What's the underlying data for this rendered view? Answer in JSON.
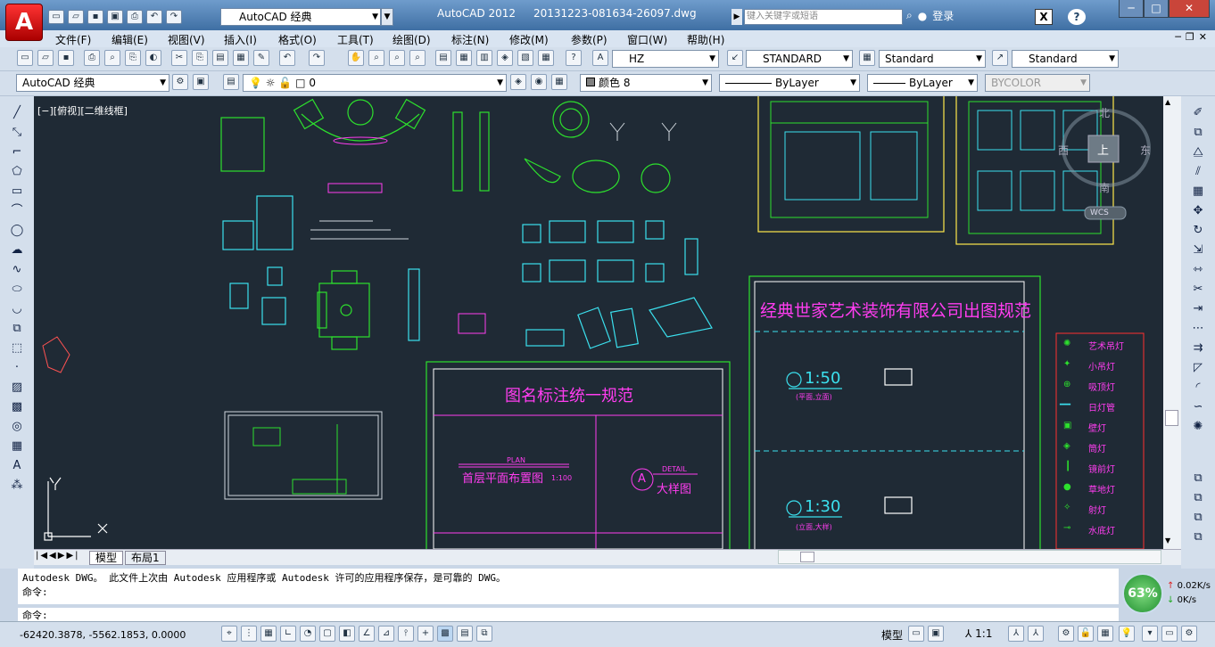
{
  "titlebar": {
    "app_name": "AutoCAD 2012",
    "file_name": "20131223-081634-26097.dwg",
    "workspace": "AutoCAD 经典",
    "search_placeholder": "键入关键字或短语",
    "login": "登录"
  },
  "menu": [
    "文件(F)",
    "编辑(E)",
    "视图(V)",
    "插入(I)",
    "格式(O)",
    "工具(T)",
    "绘图(D)",
    "标注(N)",
    "修改(M)",
    "参数(P)",
    "窗口(W)",
    "帮助(H)"
  ],
  "toolbar1": {
    "text_style": "HZ",
    "dim_style": "STANDARD",
    "table_style": "Standard",
    "mleader_style": "Standard"
  },
  "toolbar2": {
    "workspace": "AutoCAD 经典",
    "layer": "0",
    "color": "颜色 8",
    "linetype": "ByLayer",
    "lineweight": "ByLayer",
    "plotstyle": "BYCOLOR"
  },
  "viewport": {
    "label": "[−][俯视][二维线框]"
  },
  "viewcube": {
    "north": "北",
    "east": "东",
    "south": "南",
    "west": "西",
    "top": "上",
    "wcs": "WCS"
  },
  "drawing": {
    "title_main": "经典世家艺术装饰有限公司出图规范",
    "title_names": "图名标注统一规范",
    "plan_title": "首层平面布置图",
    "plan_scale": "1:100",
    "detail_title": "大样图",
    "detail_letter": "A",
    "plan_tag": "PLAN",
    "detail_tag": "DETAIL",
    "scale1": "1:50",
    "scale1_note": "(平面,立面)",
    "scale2": "1:30",
    "scale2_note": "(立面,大样)",
    "legend": [
      "艺术吊灯",
      "小吊灯",
      "吸顶灯",
      "日灯管",
      "壁灯",
      "筒灯",
      "镜前灯",
      "草地灯",
      "射灯",
      "水底灯"
    ]
  },
  "tabs": [
    "模型",
    "布局1"
  ],
  "command": {
    "line1": "Autodesk DWG。  此文件上次由 Autodesk 应用程序或 Autodesk 许可的应用程序保存，是可靠的 DWG。",
    "line2": "命令:",
    "prompt": "命令:"
  },
  "status": {
    "coords": "-62420.3878, -5562.1853, 0.0000",
    "model": "模型",
    "scale": "1:1",
    "cpu": "63%",
    "net_up": "0.02K/s",
    "net_down": "0K/s"
  }
}
